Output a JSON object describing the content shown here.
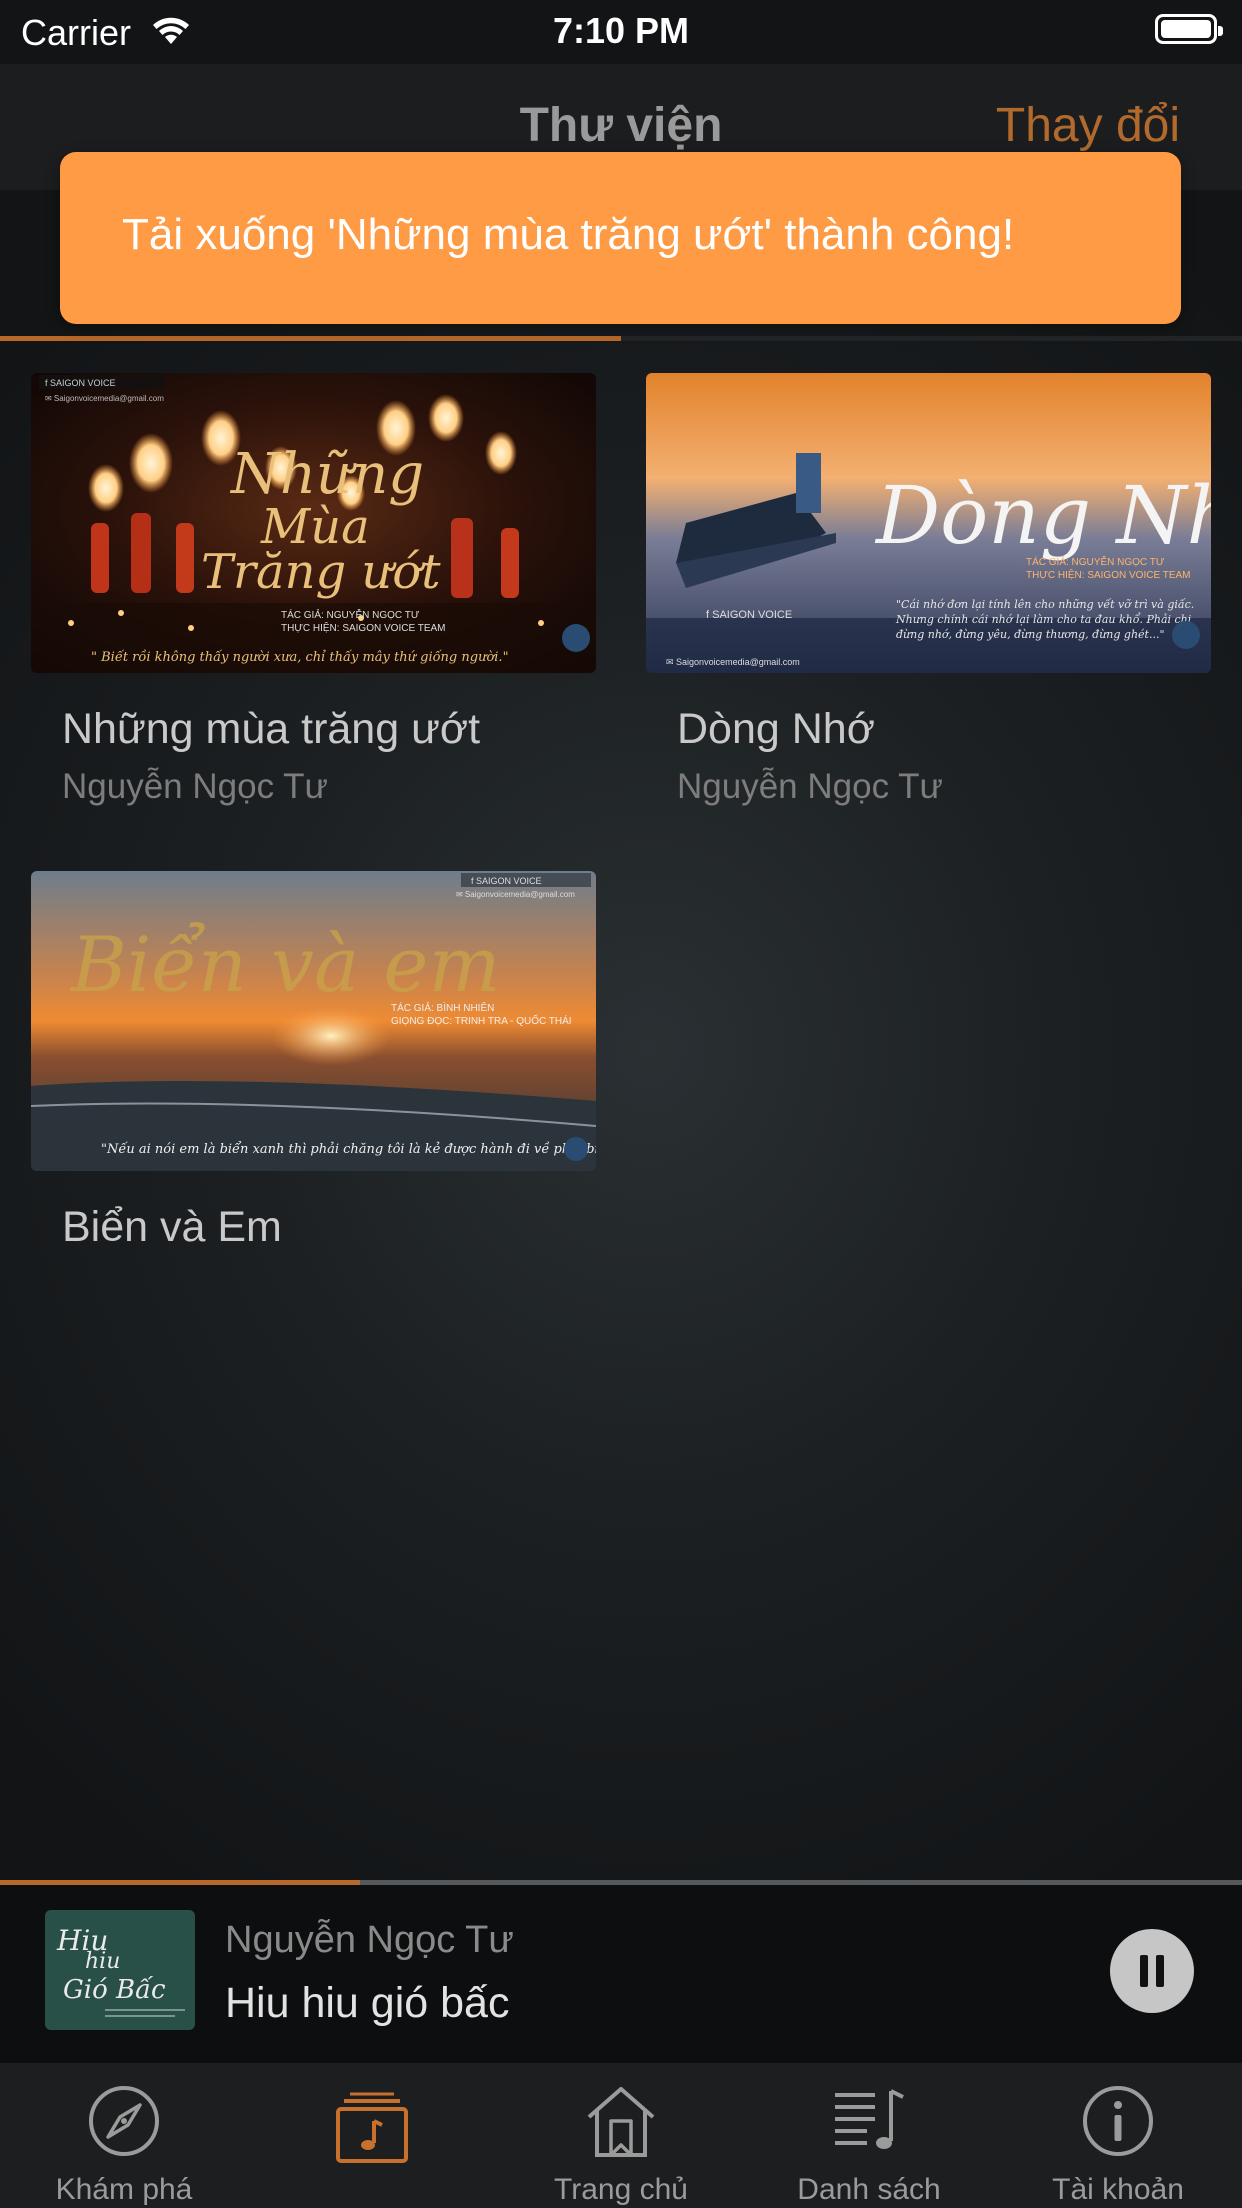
{
  "status_bar": {
    "carrier": "Carrier",
    "time": "7:10 PM"
  },
  "nav": {
    "title": "Thư viện",
    "edit_label": "Thay đổi"
  },
  "toast": {
    "message": "Tải xuống 'Những mùa trăng ướt' thành công!"
  },
  "library": {
    "items": [
      {
        "title": "Những mùa trăng ướt",
        "author": "Nguyễn Ngọc Tư",
        "cover": {
          "script_title": "Những Mùa Trăng ướt",
          "brand": "SAIGON VOICE",
          "email": "Saigonvoicemedia@gmail.com",
          "credit_author": "TÁC GIẢ: NGUYỄN NGỌC TƯ",
          "credit_team": "THỰC HIỆN: SAIGON VOICE TEAM",
          "quote": "\" Biết rồi không thấy người xưa, chỉ thấy mây thứ giống người.\""
        }
      },
      {
        "title": "Dòng Nhớ",
        "author": "Nguyễn Ngọc Tư",
        "cover": {
          "script_title": "Dòng Nhớ",
          "brand": "SAIGON VOICE",
          "email": "Saigonvoicemedia@gmail.com",
          "credit_author": "TÁC GIẢ: NGUYỄN NGỌC TƯ",
          "credit_team": "THỰC HIỆN: SAIGON VOICE TEAM",
          "quote": "\"Cái nhớ đơn lại tính lên cho những vết vỡ trì và giấc. Nhưng chính cái nhớ lại làm cho ta đau khổ. Phải chi đừng nhớ, đừng yêu, đừng thương, đừng ghét...\""
        }
      },
      {
        "title": "Biển và Em",
        "author": "",
        "cover": {
          "script_title": "Biển và em",
          "brand": "SAIGON VOICE",
          "email": "Saigonvoicemedia@gmail.com",
          "credit_author": "TÁC GIẢ: BÌNH NHIÊN",
          "credit_team": "GIỌNG ĐỌC: TRINH TRA - QUỐC THÁI",
          "quote": "\"Nếu ai nói em là biển xanh thì phải chăng tôi là kẻ được hành đi về phía biển?\""
        }
      }
    ]
  },
  "player": {
    "artist": "Nguyễn Ngọc Tư",
    "song": "Hiu hiu gió bấc",
    "cover_text": "Hiu hiu Gió Bấc",
    "progress": 0.29
  },
  "tabs": [
    {
      "label": "Khám phá",
      "icon": "compass-icon",
      "active": false
    },
    {
      "label": "",
      "icon": "music-library-icon",
      "active": true
    },
    {
      "label": "Trang chủ",
      "icon": "home-icon",
      "active": false
    },
    {
      "label": "Danh sách",
      "icon": "playlist-icon",
      "active": false
    },
    {
      "label": "Tài khoản",
      "icon": "info-icon",
      "active": false
    }
  ],
  "colors": {
    "accent": "#b8682a",
    "toast": "#ff9a45",
    "background": "#151719"
  }
}
